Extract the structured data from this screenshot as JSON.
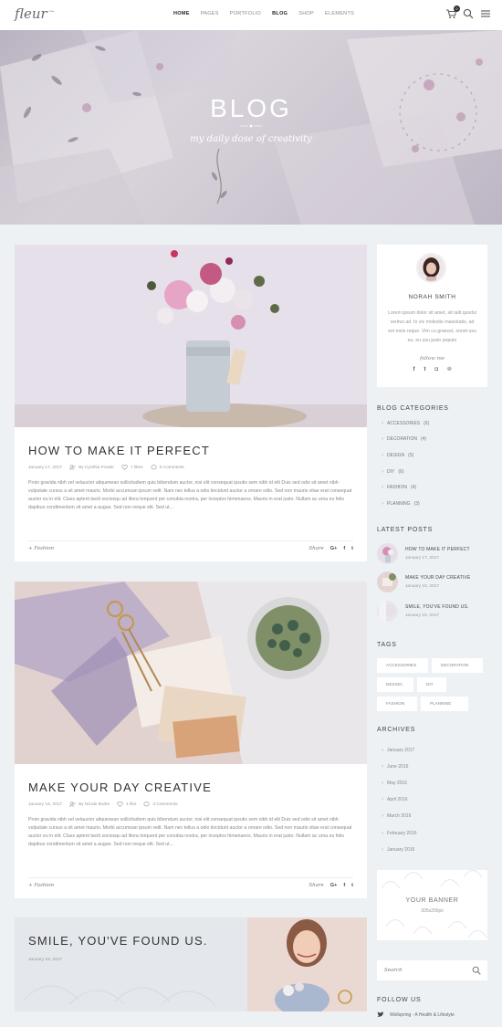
{
  "header": {
    "logo": "fleur",
    "nav": [
      "HOME",
      "PAGES",
      "PORTFOLIO",
      "BLOG",
      "SHOP",
      "ELEMENTS"
    ],
    "active_nav": "BLOG",
    "cart_count": "0"
  },
  "hero": {
    "title": "BLOG",
    "subtitle": "my daily dose of creativity"
  },
  "posts": [
    {
      "title": "HOW TO MAKE IT PERFECT",
      "date": "January 17, 2017",
      "author": "By Cynthia Fowler",
      "likes": "7 likes",
      "comments": "0 Comments",
      "excerpt": "Proin gravida nibh vel velauctor aliquenean sollicitudiem quis bibendum auctor, nisi elit consequat ipsutis sem nibh id elit Duis sed odio sit amet nibh vulputate cursus a sit amet mauris. Morbi accumsan ipsum velit. Nam nec tellus a odio tincidunt auctor a ornare odio. Sed non mauris vitae erat consequat auctor eu in elit. Class aptent taciti sociosqu ad litora torquent per conubia nostra, per inceptos himenaeos. Mauris in erat justo. Nullam ac urna eu felis dapibus condimentum sit amet a augue. Sed non neque elit. Sed ut...",
      "category": "Fashion",
      "share_label": "Share"
    },
    {
      "title": "MAKE YOUR DAY CREATIVE",
      "date": "January 16, 2017",
      "author": "By Nicole Burke",
      "likes": "1 like",
      "comments": "3 Comments",
      "excerpt": "Proin gravida nibh vel velauctor aliquenean sollicitudiem quis bibendum auctor, nisi elit consequat ipsutis sem nibh id elit Duis sed odio sit amet nibh vulputate cursus a sit amet mauris. Morbi accumsan ipsum velit. Nam nec tellus a odio tincidunt auctor a ornare odio. Sed non mauris vitae erat consequat auctor eu in elit. Class aptent taciti sociosqu ad litora torquent per conubia nostra, per inceptos himenaeos. Mauris in erat justo. Nullam ac urna eu felis dapibus condimentum sit amet a augue. Sed non neque elit. Sed ut...",
      "category": "Fashion",
      "share_label": "Share"
    },
    {
      "title": "SMILE, YOU'VE FOUND US.",
      "date": "January 15, 2017"
    }
  ],
  "author": {
    "name": "NORAH SMITH",
    "bio": "Lorem ipsum dolor sit amet, sit talit quodsi veritus ad. In vix molestie maiestatis, ad est meis reque. Vim cu graecet, sonet usu eu, eu usu justo populo",
    "follow_label": "follow me"
  },
  "sidebar": {
    "categories_heading": "BLOG CATEGORIES",
    "categories": [
      {
        "label": "ACCESSORIES",
        "count": "(6)"
      },
      {
        "label": "DECORATION",
        "count": "(4)"
      },
      {
        "label": "DESIGN",
        "count": "(5)"
      },
      {
        "label": "DIY",
        "count": "(6)"
      },
      {
        "label": "FASHION",
        "count": "(4)"
      },
      {
        "label": "PLANNING",
        "count": "(3)"
      }
    ],
    "latest_heading": "LATEST POSTS",
    "latest": [
      {
        "title": "HOW TO MAKE IT PERFECT",
        "date": "January 17, 2017"
      },
      {
        "title": "MAKE YOUR DAY CREATIVE",
        "date": "January 16, 2017"
      },
      {
        "title": "SMILE, YOU'VE FOUND US.",
        "date": "January 15, 2017"
      }
    ],
    "tags_heading": "TAGS",
    "tags": [
      "ACCESSORIES",
      "DECORATION",
      "DESIGN",
      "DIY",
      "FASHION",
      "PLANNING"
    ],
    "archives_heading": "ARCHIVES",
    "archives": [
      "January 2017",
      "June 2016",
      "May 2016",
      "April 2016",
      "March 2016",
      "February 2016",
      "January 2016"
    ],
    "banner_title": "YOUR BANNER",
    "banner_size": "305x200px",
    "search_placeholder": "Search",
    "follow_heading": "FOLLOW US",
    "follow_item": "Wellspring - A Health & Lifestyle"
  },
  "colors": {
    "page_bg": "#eef1f3",
    "card_bg": "#ffffff",
    "text_dark": "#333333",
    "text_muted": "#999999"
  }
}
